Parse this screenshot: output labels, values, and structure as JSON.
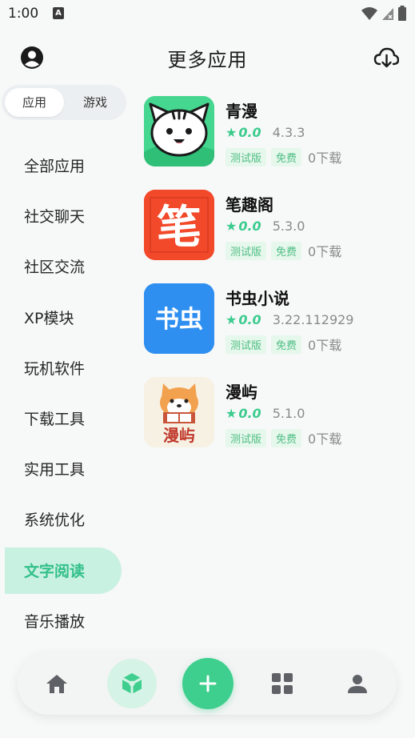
{
  "status_bar": {
    "time": "1:00",
    "a_icon": "A"
  },
  "header": {
    "title": "更多应用"
  },
  "segment": {
    "tabs": [
      "应用",
      "游戏"
    ]
  },
  "categories": [
    "全部应用",
    "社交聊天",
    "社区交流",
    "XP模块",
    "玩机软件",
    "下载工具",
    "实用工具",
    "系统优化",
    "文字阅读",
    "音乐播放"
  ],
  "selected_category": "文字阅读",
  "apps": [
    {
      "name": "青漫",
      "rating": "0.0",
      "version": "4.3.3",
      "tag1": "测试版",
      "tag2": "免费",
      "downloads": "0下载",
      "icon": "cat-face-icon"
    },
    {
      "name": "笔趣阁",
      "rating": "0.0",
      "version": "5.3.0",
      "tag1": "测试版",
      "tag2": "免费",
      "downloads": "0下载",
      "icon": "brush-character-icon",
      "icon_text": "笔"
    },
    {
      "name": "书虫小说",
      "rating": "0.0",
      "version": "3.22.112929",
      "tag1": "测试版",
      "tag2": "免费",
      "downloads": "0下载",
      "icon": "text-logo-icon",
      "icon_text": "书虫"
    },
    {
      "name": "漫屿",
      "rating": "0.0",
      "version": "5.1.0",
      "tag1": "测试版",
      "tag2": "免费",
      "downloads": "0下载",
      "icon": "shiba-reading-icon",
      "icon_text": "漫屿"
    }
  ],
  "bottom_nav": [
    "home-icon",
    "cube-icon",
    "plus-icon",
    "grid-icon",
    "person-icon"
  ],
  "colors": {
    "accent": "#3ecf8e",
    "accent_light": "#c9f1e1",
    "star": "#3ccc8e",
    "tag_bg": "#e6f7ec",
    "bizuge_red": "#f2492a",
    "shuchong_blue": "#2f8ff0",
    "qingman_green": "#45d68f"
  }
}
